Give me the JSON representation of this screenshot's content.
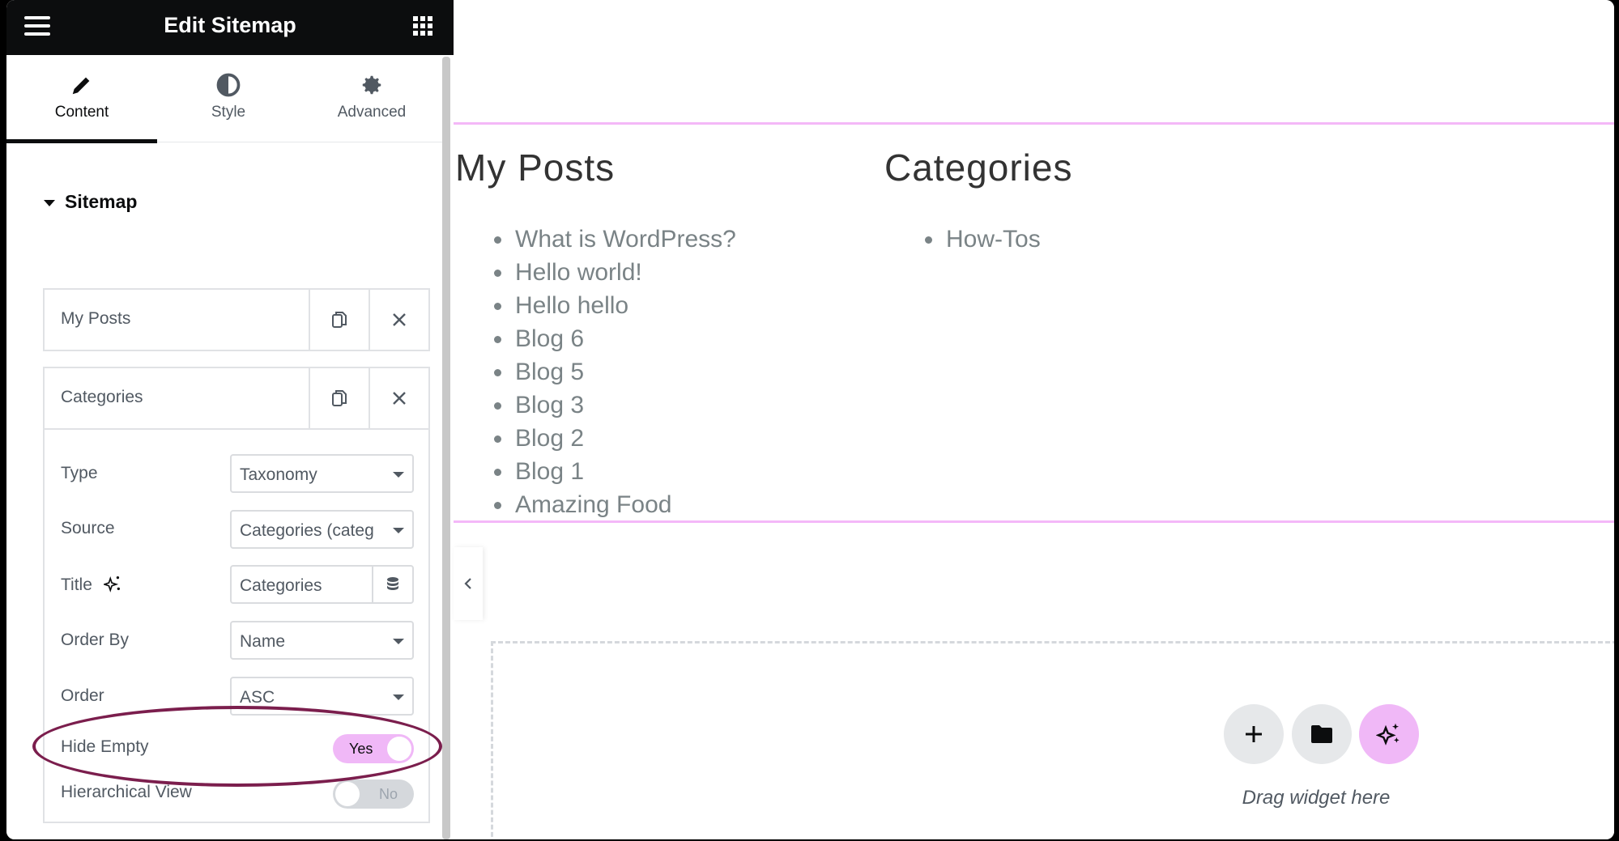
{
  "panel": {
    "title": "Edit Sitemap",
    "tabs": [
      {
        "label": "Content",
        "icon": "pencil-icon",
        "active": true
      },
      {
        "label": "Style",
        "icon": "half-circle-icon",
        "active": false
      },
      {
        "label": "Advanced",
        "icon": "gear-icon",
        "active": false
      }
    ],
    "section": "Sitemap",
    "items": [
      {
        "label": "My Posts"
      },
      {
        "label": "Categories"
      }
    ],
    "controls": {
      "type": {
        "label": "Type",
        "value": "Taxonomy"
      },
      "source": {
        "label": "Source",
        "value": "Categories (categ"
      },
      "title": {
        "label": "Title",
        "value": "Categories"
      },
      "order_by": {
        "label": "Order By",
        "value": "Name"
      },
      "order": {
        "label": "Order",
        "value": "ASC"
      },
      "hide_empty": {
        "label": "Hide Empty",
        "value": "Yes",
        "on": true
      },
      "hierarchical": {
        "label": "Hierarchical View",
        "value": "No",
        "on": false
      }
    }
  },
  "canvas": {
    "columns": [
      {
        "title": "My Posts",
        "items": [
          "What is WordPress?",
          "Hello world!",
          "Hello hello",
          "Blog 6",
          "Blog 5",
          "Blog 3",
          "Blog 2",
          "Blog 1",
          "Amazing Food"
        ]
      },
      {
        "title": "Categories",
        "items": [
          "How-Tos"
        ]
      }
    ],
    "drop_text": "Drag widget here"
  },
  "colors": {
    "accent": "#f0b8f7",
    "highlight": "#7b1e4d",
    "topbar": "#0c0d0e"
  }
}
